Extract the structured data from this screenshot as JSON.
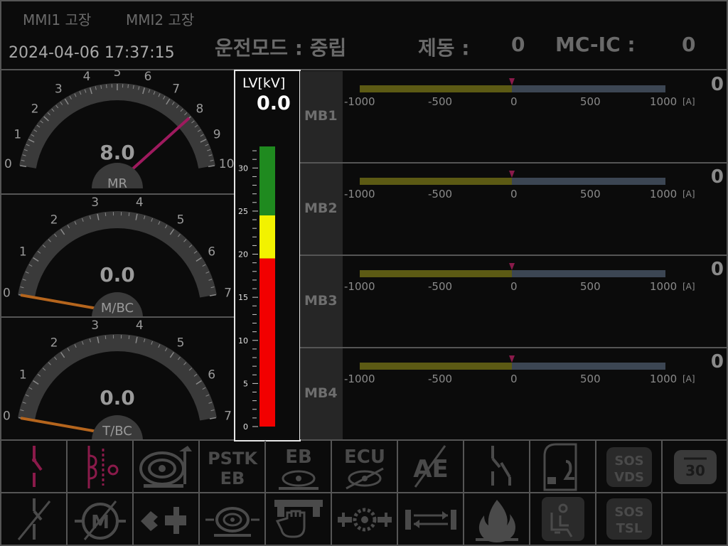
{
  "header": {
    "mmi1": "MMI1 고장",
    "mmi2": "MMI2 고장",
    "datetime": "2024-04-06 17:37:15",
    "mode": "운전모드 : 중립",
    "brake_label": "제동 :",
    "brake_value": "0",
    "mcic_label": "MC-IC :",
    "mcic_value": "0"
  },
  "gauges": [
    {
      "id": "mr",
      "label": "MR",
      "value_text": "8.0",
      "value": 8.0,
      "max": 10,
      "ticks": [
        "0",
        "1",
        "2",
        "3",
        "4",
        "5",
        "6",
        "7",
        "8",
        "9",
        "10"
      ],
      "needle_color": "#9e1a5e"
    },
    {
      "id": "mbc",
      "label": "M/BC",
      "value_text": "0.0",
      "value": 0.0,
      "max": 7,
      "ticks": [
        "0",
        "1",
        "2",
        "3",
        "4",
        "5",
        "6",
        "7"
      ],
      "needle_color": "#b5651d"
    },
    {
      "id": "tbc",
      "label": "T/BC",
      "value_text": "0.0",
      "value": 0.0,
      "max": 7,
      "ticks": [
        "0",
        "1",
        "2",
        "3",
        "4",
        "5",
        "6",
        "7"
      ],
      "needle_color": "#b5651d"
    }
  ],
  "lv": {
    "title": "LV[kV]",
    "value": "0.0",
    "scale_labels": [
      "30",
      "25",
      "20",
      "15",
      "10",
      "5",
      "0"
    ],
    "colors": {
      "green": "#1f8a1f",
      "yellow": "#f2f200",
      "red": "#f20000"
    }
  },
  "mb_rows": [
    {
      "label": "MB1",
      "value": "0"
    },
    {
      "label": "MB2",
      "value": "0"
    },
    {
      "label": "MB3",
      "value": "0"
    },
    {
      "label": "MB4",
      "value": "0"
    }
  ],
  "mb_axis": {
    "ticks": [
      "-1000",
      "-500",
      "0",
      "500",
      "1000"
    ],
    "unit": "[A]"
  },
  "icons_row1": [
    {
      "name": "breaker-open-icon",
      "color": "#8a1a4a"
    },
    {
      "name": "coil-contactor-icon",
      "color": "#8a1a4a"
    },
    {
      "name": "compressor-icon",
      "color": "#4a4a4a"
    },
    {
      "name": "pstk-eb-icon",
      "text1": "PSTK",
      "text2": "EB"
    },
    {
      "name": "eb-icon",
      "text1": "EB"
    },
    {
      "name": "ecu-icon",
      "text1": "ECU"
    },
    {
      "name": "ae-icon",
      "text1": "AE"
    },
    {
      "name": "switch-icon",
      "color": "#4a4a4a"
    },
    {
      "name": "door-driver-icon",
      "color": "#4a4a4a"
    },
    {
      "name": "sos-vds-icon",
      "text1": "SOS",
      "text2": "VDS"
    },
    {
      "name": "timer-30-icon",
      "text1": "30"
    }
  ],
  "icons_row2": [
    {
      "name": "switch-slash-icon"
    },
    {
      "name": "motor-slash-icon",
      "text1": "M"
    },
    {
      "name": "coupling-icon"
    },
    {
      "name": "brake-wheel-icon"
    },
    {
      "name": "hand-icon"
    },
    {
      "name": "gear-spark-icon"
    },
    {
      "name": "coupler-arrows-icon"
    },
    {
      "name": "fire-icon"
    },
    {
      "name": "driver-seat-icon"
    },
    {
      "name": "sos-tsl-icon",
      "text1": "SOS",
      "text2": "TSL"
    }
  ]
}
